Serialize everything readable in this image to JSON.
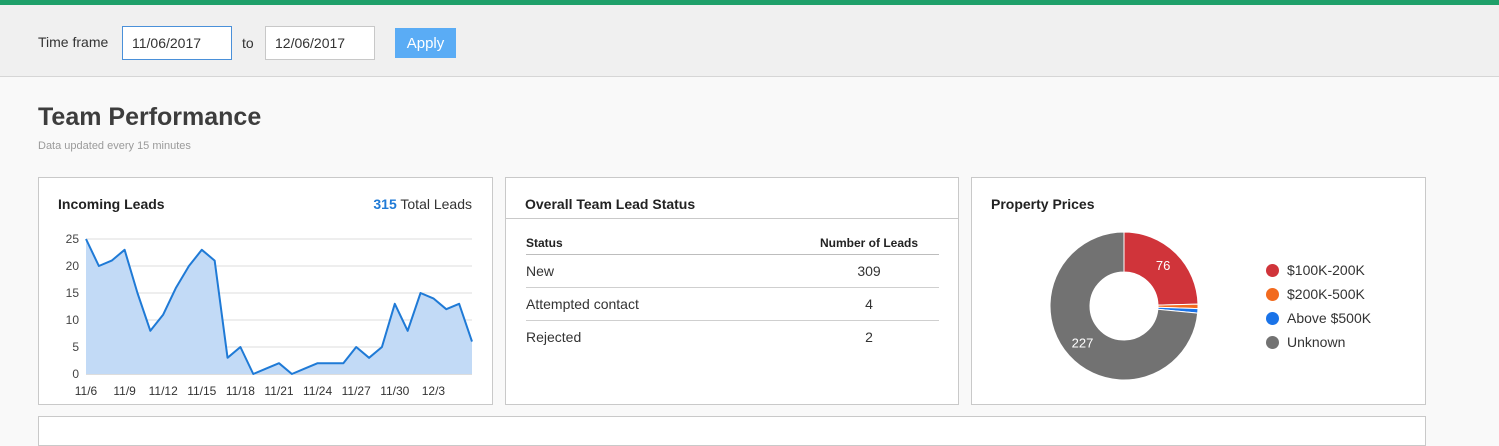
{
  "filter": {
    "label": "Time frame",
    "from_value": "11/06/2017",
    "to_label": "to",
    "to_value": "12/06/2017",
    "apply_label": "Apply"
  },
  "header": {
    "title": "Team Performance",
    "subtitle": "Data updated every 15 minutes"
  },
  "incoming_leads": {
    "title": "Incoming Leads",
    "total_value": "315",
    "total_label": "Total Leads"
  },
  "lead_status": {
    "title": "Overall Team Lead Status",
    "columns": [
      "Status",
      "Number of Leads"
    ],
    "rows": [
      {
        "status": "New",
        "count": "309"
      },
      {
        "status": "Attempted contact",
        "count": "4"
      },
      {
        "status": "Rejected",
        "count": "2"
      }
    ]
  },
  "property_prices": {
    "title": "Property Prices"
  },
  "colors": {
    "accent_green": "#1fa06a",
    "apply_blue": "#5aacf5",
    "line_blue": "#1f7ad6",
    "area_blue": "#c2daf6"
  },
  "chart_data": [
    {
      "type": "area",
      "x": [
        "11/6",
        "11/7",
        "11/8",
        "11/9",
        "11/10",
        "11/11",
        "11/12",
        "11/13",
        "11/14",
        "11/15",
        "11/16",
        "11/17",
        "11/18",
        "11/19",
        "11/20",
        "11/21",
        "11/22",
        "11/23",
        "11/24",
        "11/25",
        "11/26",
        "11/27",
        "11/28",
        "11/29",
        "11/30",
        "12/1",
        "12/2",
        "12/3",
        "12/4",
        "12/5",
        "12/6"
      ],
      "series": [
        {
          "values": [
            25,
            20,
            21,
            23,
            15,
            8,
            11,
            16,
            20,
            23,
            21,
            3,
            5,
            0,
            1,
            2,
            0,
            1,
            2,
            2,
            2,
            5,
            3,
            5,
            13,
            8,
            15,
            14,
            12,
            13,
            6
          ]
        }
      ],
      "x_tick_labels": [
        "11/6",
        "11/9",
        "11/12",
        "11/15",
        "11/18",
        "11/21",
        "11/24",
        "11/27",
        "11/30",
        "12/3"
      ],
      "y_ticks": [
        0,
        5,
        10,
        15,
        20,
        25
      ],
      "ylim": [
        0,
        25
      ],
      "grid": true,
      "title": "",
      "xlabel": "",
      "ylabel": ""
    },
    {
      "type": "pie",
      "labels": [
        "$100K-200K",
        "$200K-500K",
        "Above $500K",
        "Unknown"
      ],
      "values": [
        76,
        3,
        3,
        227
      ],
      "data_labels": [
        "76",
        "",
        "",
        "227"
      ],
      "colors": [
        "#d0343a",
        "#f26a1e",
        "#1a73e8",
        "#727272"
      ],
      "donut": true,
      "legend": "right"
    }
  ]
}
